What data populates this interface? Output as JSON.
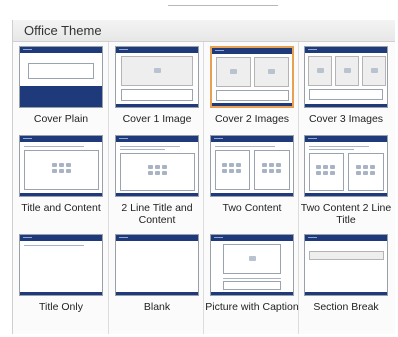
{
  "window": {
    "title": "Office Theme"
  },
  "layouts": [
    {
      "label": "Cover Plain"
    },
    {
      "label": "Cover 1 Image"
    },
    {
      "label": "Cover 2 Images"
    },
    {
      "label": "Cover 3 Images"
    },
    {
      "label": "Title and Content"
    },
    {
      "label": "2 Line Title and Content"
    },
    {
      "label": "Two Content"
    },
    {
      "label": "Two Content 2 Line Title"
    },
    {
      "label": "Title Only"
    },
    {
      "label": "Blank"
    },
    {
      "label": "Picture with Caption"
    },
    {
      "label": "Section Break"
    }
  ],
  "selected_layout": "Cover 2 Images",
  "colors": {
    "accent_navy": "#1f3a7a",
    "selection": "#e9a050"
  }
}
